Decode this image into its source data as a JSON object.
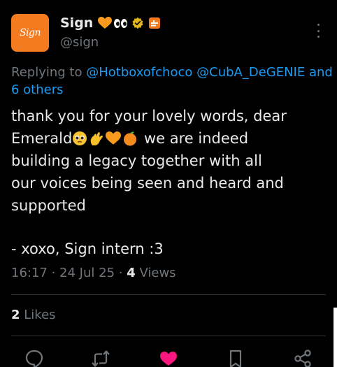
{
  "author": {
    "display_name": "Sign",
    "handle": "@sign",
    "avatar_text": "Sign",
    "name_badges": [
      "orange-heart-icon",
      "eyes-icon",
      "verified-badge-icon",
      "affiliate-badge-icon"
    ]
  },
  "reply": {
    "prefix": "Replying to",
    "mention_1": "@Hotboxofchoco",
    "mention_2": "@CubA_DeGENIE",
    "and_text": "and",
    "others": "6 others"
  },
  "tweet": {
    "line_1": "thank you for your lovely words, dear",
    "line_2_start": "Emerald",
    "line_2_emojis": [
      "pleading-face-emoji",
      "pinching-hand-emoji",
      "orange-heart-emoji",
      "tangerine-emoji"
    ],
    "line_2_end": " we are indeed",
    "line_3": "building a legacy together with all",
    "line_4": "our voices being seen and heard and",
    "line_5": "supported",
    "signoff": "- xoxo, Sign intern :3"
  },
  "meta": {
    "time": "16:17",
    "sep": " · ",
    "date": "24 Jul 25",
    "views_count": "4",
    "views_label": "Views"
  },
  "engagement": {
    "likes_count": "2",
    "likes_label": "Likes"
  },
  "actions": [
    "reply-icon",
    "retweet-icon",
    "like-icon-filled",
    "bookmark-icon",
    "share-icon"
  ],
  "colors": {
    "background": "#000000",
    "text": "#e7e9ea",
    "muted": "#71767b",
    "link": "#1d9bf0",
    "brand_orange": "#f47b20",
    "like_pink": "#f91880",
    "divider": "#2f3336"
  }
}
